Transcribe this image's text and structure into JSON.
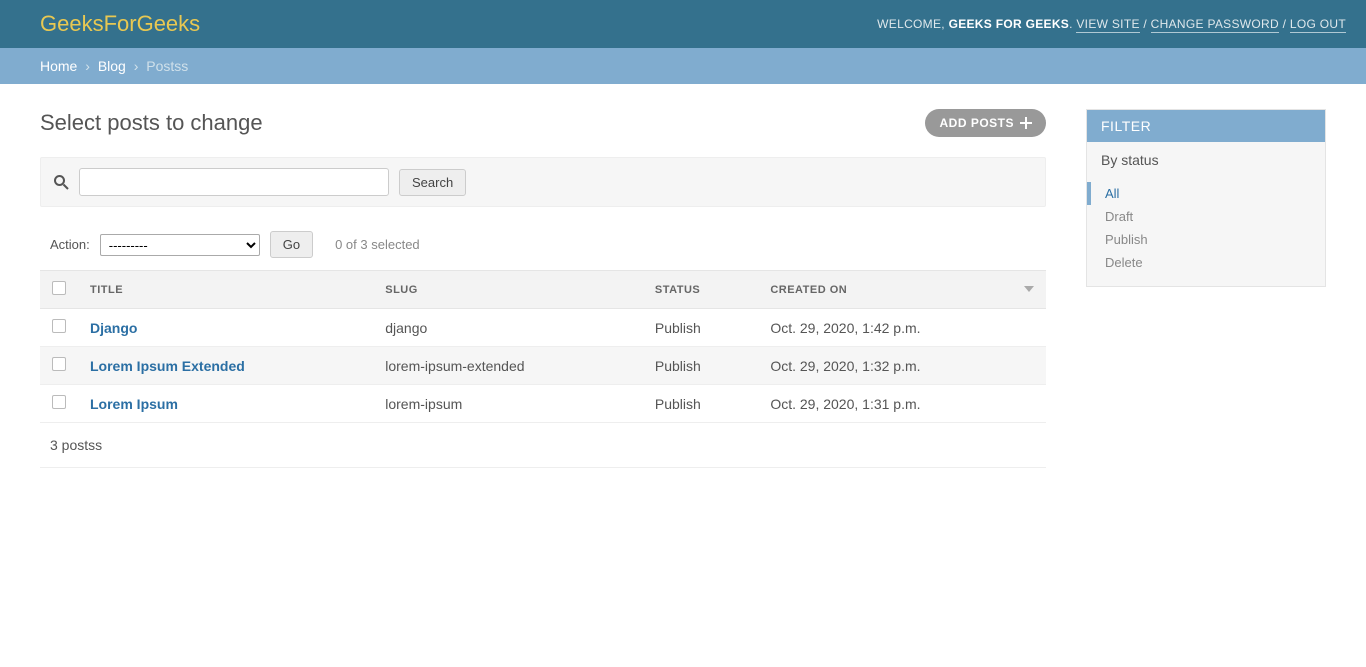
{
  "header": {
    "brand": "GeeksForGeeks",
    "welcome": "WELCOME,",
    "username": "GEEKS FOR GEEKS",
    "view_site": "VIEW SITE",
    "change_password": "CHANGE PASSWORD",
    "logout": "LOG OUT"
  },
  "breadcrumbs": {
    "home": "Home",
    "app": "Blog",
    "current": "Postss"
  },
  "page": {
    "title": "Select posts to change",
    "add_button": "ADD POSTS"
  },
  "search": {
    "button": "Search"
  },
  "actions": {
    "label": "Action:",
    "placeholder": "---------",
    "go": "Go",
    "selection": "0 of 3 selected"
  },
  "columns": {
    "title": "TITLE",
    "slug": "SLUG",
    "status": "STATUS",
    "created": "CREATED ON"
  },
  "rows": [
    {
      "title": "Django",
      "slug": "django",
      "status": "Publish",
      "created": "Oct. 29, 2020, 1:42 p.m."
    },
    {
      "title": "Lorem Ipsum Extended",
      "slug": "lorem-ipsum-extended",
      "status": "Publish",
      "created": "Oct. 29, 2020, 1:32 p.m."
    },
    {
      "title": "Lorem Ipsum",
      "slug": "lorem-ipsum",
      "status": "Publish",
      "created": "Oct. 29, 2020, 1:31 p.m."
    }
  ],
  "paginator": {
    "text": "3 postss"
  },
  "filter": {
    "header": "FILTER",
    "section": "By status",
    "options": [
      "All",
      "Draft",
      "Publish",
      "Delete"
    ],
    "active": "All"
  }
}
